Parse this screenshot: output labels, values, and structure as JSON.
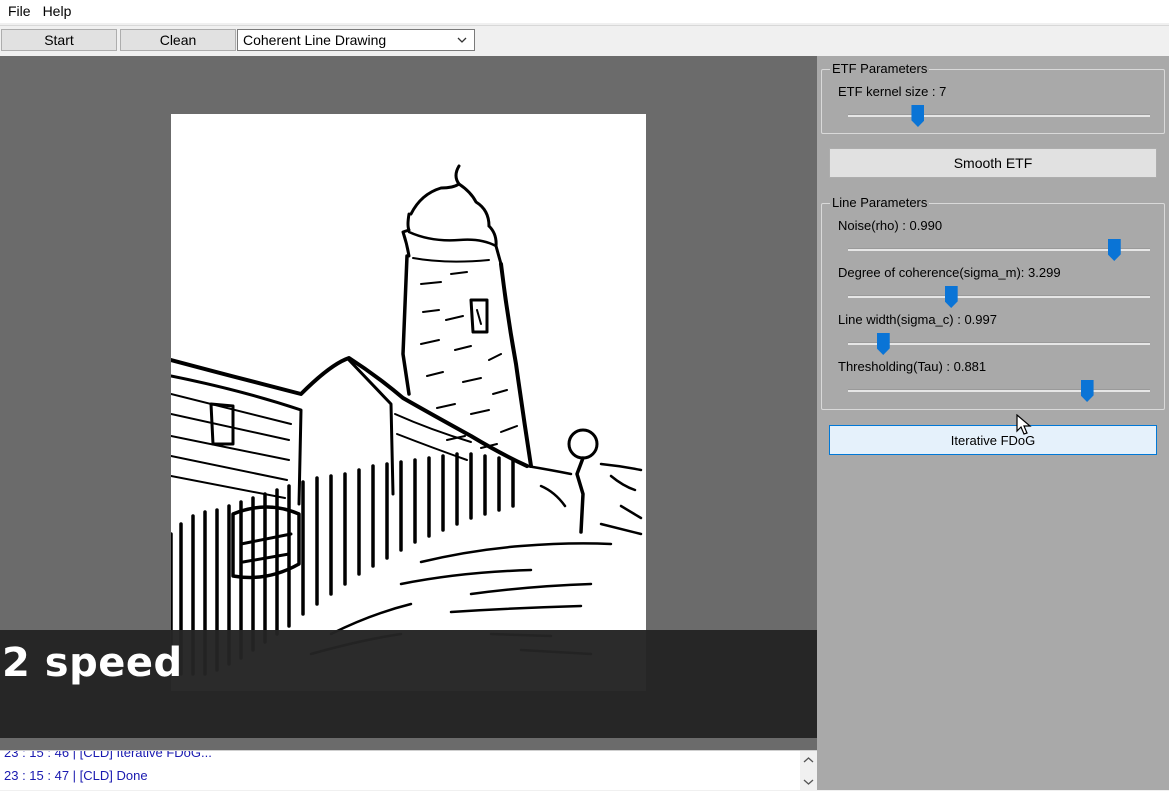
{
  "menu": {
    "file": "File",
    "help": "Help"
  },
  "toolbar": {
    "start_label": "Start",
    "clean_label": "Clean",
    "mode_selected": "Coherent Line Drawing"
  },
  "overlay": {
    "text": "2 speed"
  },
  "etf": {
    "group_title": "ETF Parameters",
    "kernel_label": "ETF kernel size : 7",
    "kernel_slider": 0.23,
    "smooth_label": "Smooth ETF"
  },
  "line": {
    "group_title": "Line Parameters",
    "noise_label": "Noise(rho) : 0.990",
    "noise_slider": 0.88,
    "coherence_label": "Degree of coherence(sigma_m): 3.299",
    "coherence_slider": 0.34,
    "width_label": "Line width(sigma_c) : 0.997",
    "width_slider": 0.115,
    "threshold_label": "Thresholding(Tau) : 0.881",
    "threshold_slider": 0.79,
    "fdog_label": "Iterative FDoG"
  },
  "log": {
    "lines": [
      "23 : 15 : 46  |  [CLD] Iterative FDoG...",
      "23 : 15 : 47  |  [CLD] Done"
    ]
  },
  "colors": {
    "accent": "#0a74d6",
    "panel_bg": "#a9a9a9",
    "canvas_bg": "#6b6b6b",
    "log_text": "#1a1ab0"
  }
}
